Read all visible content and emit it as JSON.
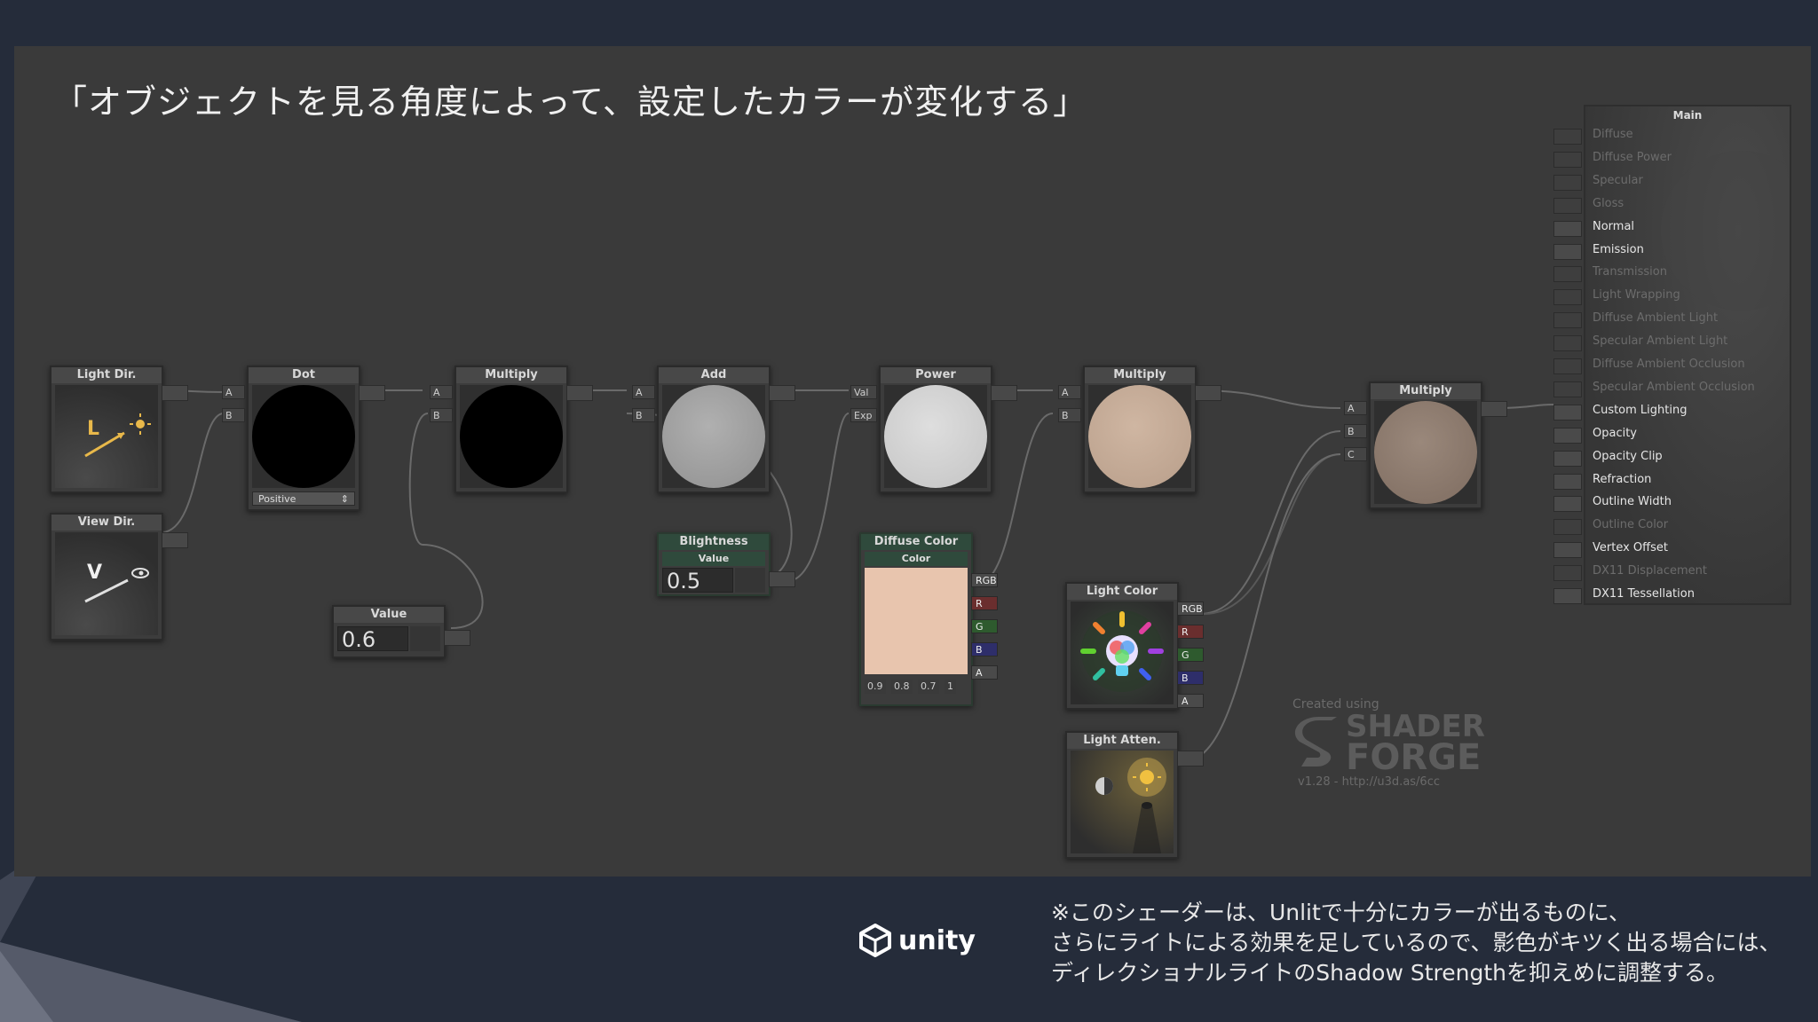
{
  "slide": {
    "title": "「オブジェクトを見る角度によって、設定したカラーが変化する」",
    "footer_lines": [
      "※このシェーダーは、Unlitで十分にカラーが出るものに、",
      "さらにライトによる効果を足しているので、影色がキツく出る場合には、",
      "ディレクショナルライトのShadow Strengthを抑えめに調整する。"
    ],
    "logo_text": "unity"
  },
  "nodes": {
    "light_dir": {
      "title": "Light Dir.",
      "icon_letter": "L"
    },
    "view_dir": {
      "title": "View Dir.",
      "icon_letter": "V"
    },
    "dot": {
      "title": "Dot",
      "port_a": "A",
      "port_b": "B",
      "mode": "Positive"
    },
    "multiply1": {
      "title": "Multiply",
      "port_a": "A",
      "port_b": "B"
    },
    "value1": {
      "title": "Value",
      "value": "0.6"
    },
    "add": {
      "title": "Add",
      "port_a": "A",
      "port_b": "B"
    },
    "brightness": {
      "title": "Blightness",
      "sub": "Value",
      "value": "0.5"
    },
    "power": {
      "title": "Power",
      "port_val": "Val",
      "port_exp": "Exp"
    },
    "diffuse_color": {
      "title": "Diffuse Color",
      "sub": "Color",
      "channels": [
        "RGB",
        "R",
        "G",
        "B",
        "A"
      ],
      "values": [
        "0.9",
        "0.8",
        "0.7",
        "1"
      ],
      "swatch": "#e8c5ae"
    },
    "multiply2": {
      "title": "Multiply",
      "port_a": "A",
      "port_b": "B"
    },
    "light_color": {
      "title": "Light Color",
      "channels": [
        "RGB",
        "R",
        "G",
        "B",
        "A"
      ]
    },
    "light_atten": {
      "title": "Light Atten."
    },
    "multiply3": {
      "title": "Multiply",
      "port_a": "A",
      "port_b": "B",
      "port_c": "C"
    }
  },
  "main_node": {
    "title": "Main",
    "inputs": [
      {
        "label": "Diffuse",
        "active": false
      },
      {
        "label": "Diffuse Power",
        "active": false
      },
      {
        "label": "Specular",
        "active": false
      },
      {
        "label": "Gloss",
        "active": false
      },
      {
        "label": "Normal",
        "active": true
      },
      {
        "label": "Emission",
        "active": true
      },
      {
        "label": "Transmission",
        "active": false
      },
      {
        "label": "Light Wrapping",
        "active": false
      },
      {
        "label": "Diffuse Ambient Light",
        "active": false
      },
      {
        "label": "Specular Ambient Light",
        "active": false
      },
      {
        "label": "Diffuse Ambient Occlusion",
        "active": false
      },
      {
        "label": "Specular Ambient Occlusion",
        "active": false
      },
      {
        "label": "Custom Lighting",
        "active": true
      },
      {
        "label": "Opacity",
        "active": true
      },
      {
        "label": "Opacity Clip",
        "active": true
      },
      {
        "label": "Refraction",
        "active": true
      },
      {
        "label": "Outline Width",
        "active": true
      },
      {
        "label": "Outline Color",
        "active": false
      },
      {
        "label": "Vertex Offset",
        "active": true
      },
      {
        "label": "DX11 Displacement",
        "active": false
      },
      {
        "label": "DX11 Tessellation",
        "active": true
      }
    ]
  },
  "watermark": {
    "created": "Created using",
    "brand_line1": "SHADER",
    "brand_line2": "FORGE",
    "version": "v1.28 - http://u3d.as/6cc"
  },
  "colors": {
    "sphere_black": "#000000",
    "sphere_add": "#a2a2a2",
    "sphere_power": "#d2d2d2",
    "sphere_mult2": "#c5ab98",
    "sphere_mult3": "#8c7a6e"
  }
}
